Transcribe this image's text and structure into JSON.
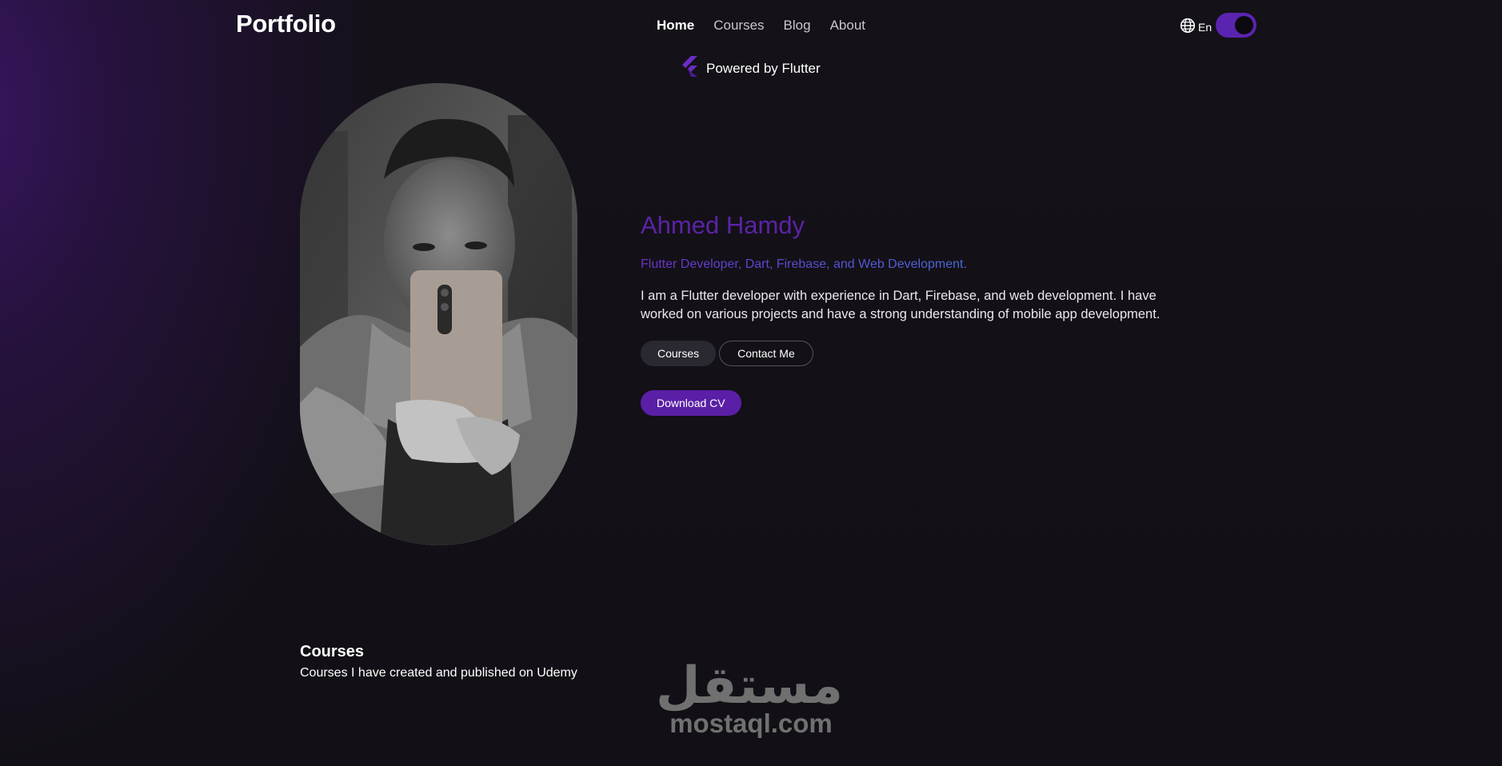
{
  "header": {
    "brand": "Portfolio",
    "nav": [
      {
        "label": "Home",
        "active": true
      },
      {
        "label": "Courses",
        "active": false
      },
      {
        "label": "Blog",
        "active": false
      },
      {
        "label": "About",
        "active": false
      }
    ],
    "language_icon": "globe-icon",
    "language": "En",
    "theme_toggle_on": true
  },
  "banner": {
    "icon": "flutter-logo-icon",
    "text": "Powered by Flutter"
  },
  "hero": {
    "photo_alt": "profile-photo",
    "name": "Ahmed Hamdy",
    "role": "Flutter Developer, Dart, Firebase, and Web Development.",
    "bio": "I am a Flutter developer with experience in Dart, Firebase, and web development. I have worked on various projects and have a strong understanding of mobile app development.",
    "buttons": {
      "courses": "Courses",
      "contact": "Contact Me",
      "download": "Download CV"
    }
  },
  "courses_section": {
    "title": "Courses",
    "subtitle": "Courses I have created and published on Udemy"
  },
  "watermark": {
    "arabic": "مستقل",
    "latin": "mostaql.com"
  },
  "colors": {
    "accent": "#5a1fa6",
    "name": "#5b23a6",
    "background": "#121016",
    "toggle": "#5a24b0"
  }
}
